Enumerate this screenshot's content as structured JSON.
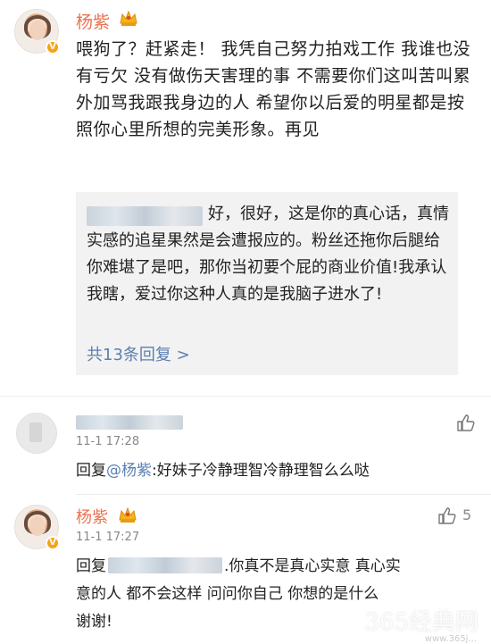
{
  "post": {
    "username": "杨紫",
    "text": "喂狗了？赶紧走！ 我凭自己努力拍戏工作 我谁也没有亏欠 没有做伤天害理的事 不需要你们这叫苦叫累外加骂我跟我身边的人 希望你以后爱的明星都是按照你心里所想的完美形象。再见"
  },
  "quoted_comment": {
    "text": "好，很好，这是你的真心话，真情实感的追星果然是会遭报应的。粉丝还拖你后腿给你难堪了是吧，那你当初要个屁的商业价值!我承认我瞎，爱过你这种人真的是我脑子进水了!",
    "replies_link": "共13条回复 >"
  },
  "comments": [
    {
      "time": "11-1 17:28",
      "reply_prefix": "回复",
      "mention": "@杨紫",
      "text": ":好妹子冷静理智冷静理智么么哒"
    },
    {
      "username": "杨紫",
      "time": "11-1 17:27",
      "like_count": "5",
      "reply_prefix": "回复",
      "line1": ".你真不是真心实意 真心实",
      "line2": "意的人 都不会这样 问问你自己 你想的是什么",
      "line3": "谢谢!"
    }
  ],
  "watermark": "365经典网",
  "watermark_sub": "www.365j...",
  "colors": {
    "username": "#eb7350",
    "link": "#5b7fb0",
    "quote_bg": "#f2f2f2"
  }
}
